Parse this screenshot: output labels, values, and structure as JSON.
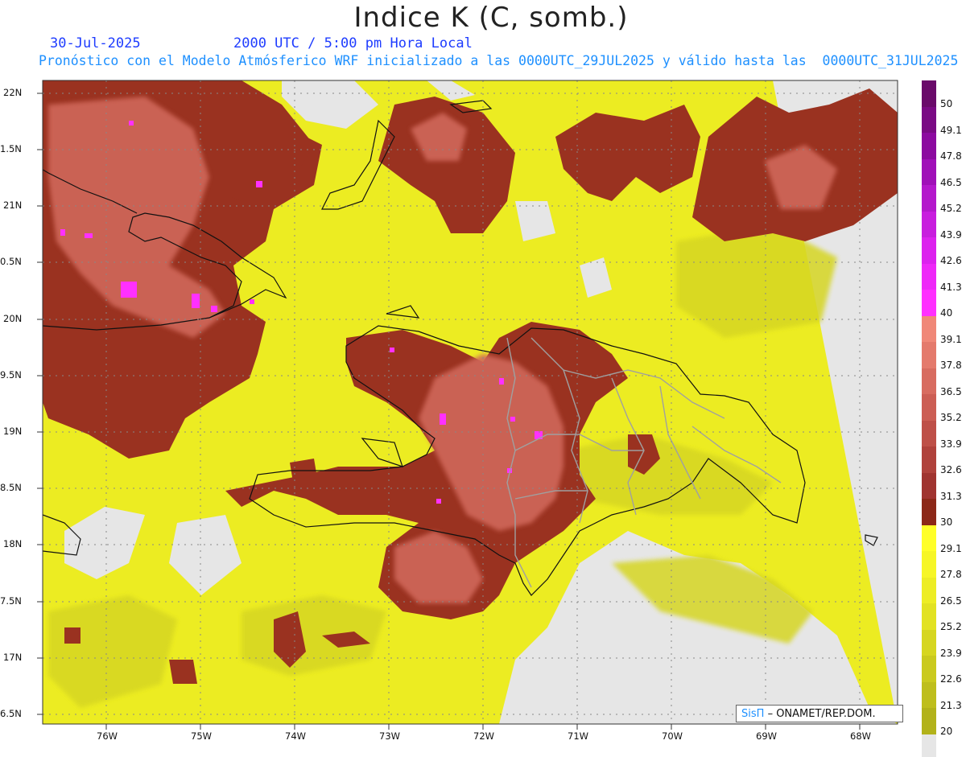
{
  "title": "Indice K (C, somb.)",
  "header": {
    "date": "30-Jul-2025",
    "time": "2000 UTC / 5:00 pm Hora Local",
    "subtitle": "Pronóstico con el Modelo Atmósferico WRF inicializado a las 0000UTC_29JUL2025 y válido hasta las  0000UTC_31JUL2025"
  },
  "credit": {
    "logo": "SisΠ",
    "text": "– ONAMET/REP.DOM."
  },
  "axes": {
    "lat_labels": [
      "22N",
      "1.5N",
      "21N",
      "0.5N",
      "20N",
      "9.5N",
      "19N",
      "8.5N",
      "18N",
      "7.5N",
      "17N",
      "6.5N"
    ],
    "lon_labels": [
      "76W",
      "75W",
      "74W",
      "73W",
      "72W",
      "71W",
      "70W",
      "69W",
      "68W"
    ]
  },
  "legend": {
    "levels": [
      "50",
      "49.1",
      "47.8",
      "46.5",
      "45.2",
      "43.9",
      "42.6",
      "41.3",
      "40",
      "39.1",
      "37.8",
      "36.5",
      "35.2",
      "33.9",
      "32.6",
      "31.3",
      "30",
      "29.1",
      "27.8",
      "26.5",
      "25.2",
      "23.9",
      "22.6",
      "21.3",
      "20"
    ],
    "colors": [
      "#6a0a6a",
      "#7a0a84",
      "#8c0aa0",
      "#a010b8",
      "#b418cc",
      "#c81ede",
      "#dc22ee",
      "#ee28f8",
      "#ff30ff",
      "#f08878",
      "#e47a6c",
      "#d86c60",
      "#cc5e54",
      "#be5048",
      "#b0423c",
      "#a03430",
      "#8c2818",
      "#ffff28",
      "#f6f626",
      "#eded24",
      "#e2e222",
      "#d6d620",
      "#caca1e",
      "#bebe1c",
      "#b2b21a"
    ],
    "below_color": "#e6e6e6"
  }
}
